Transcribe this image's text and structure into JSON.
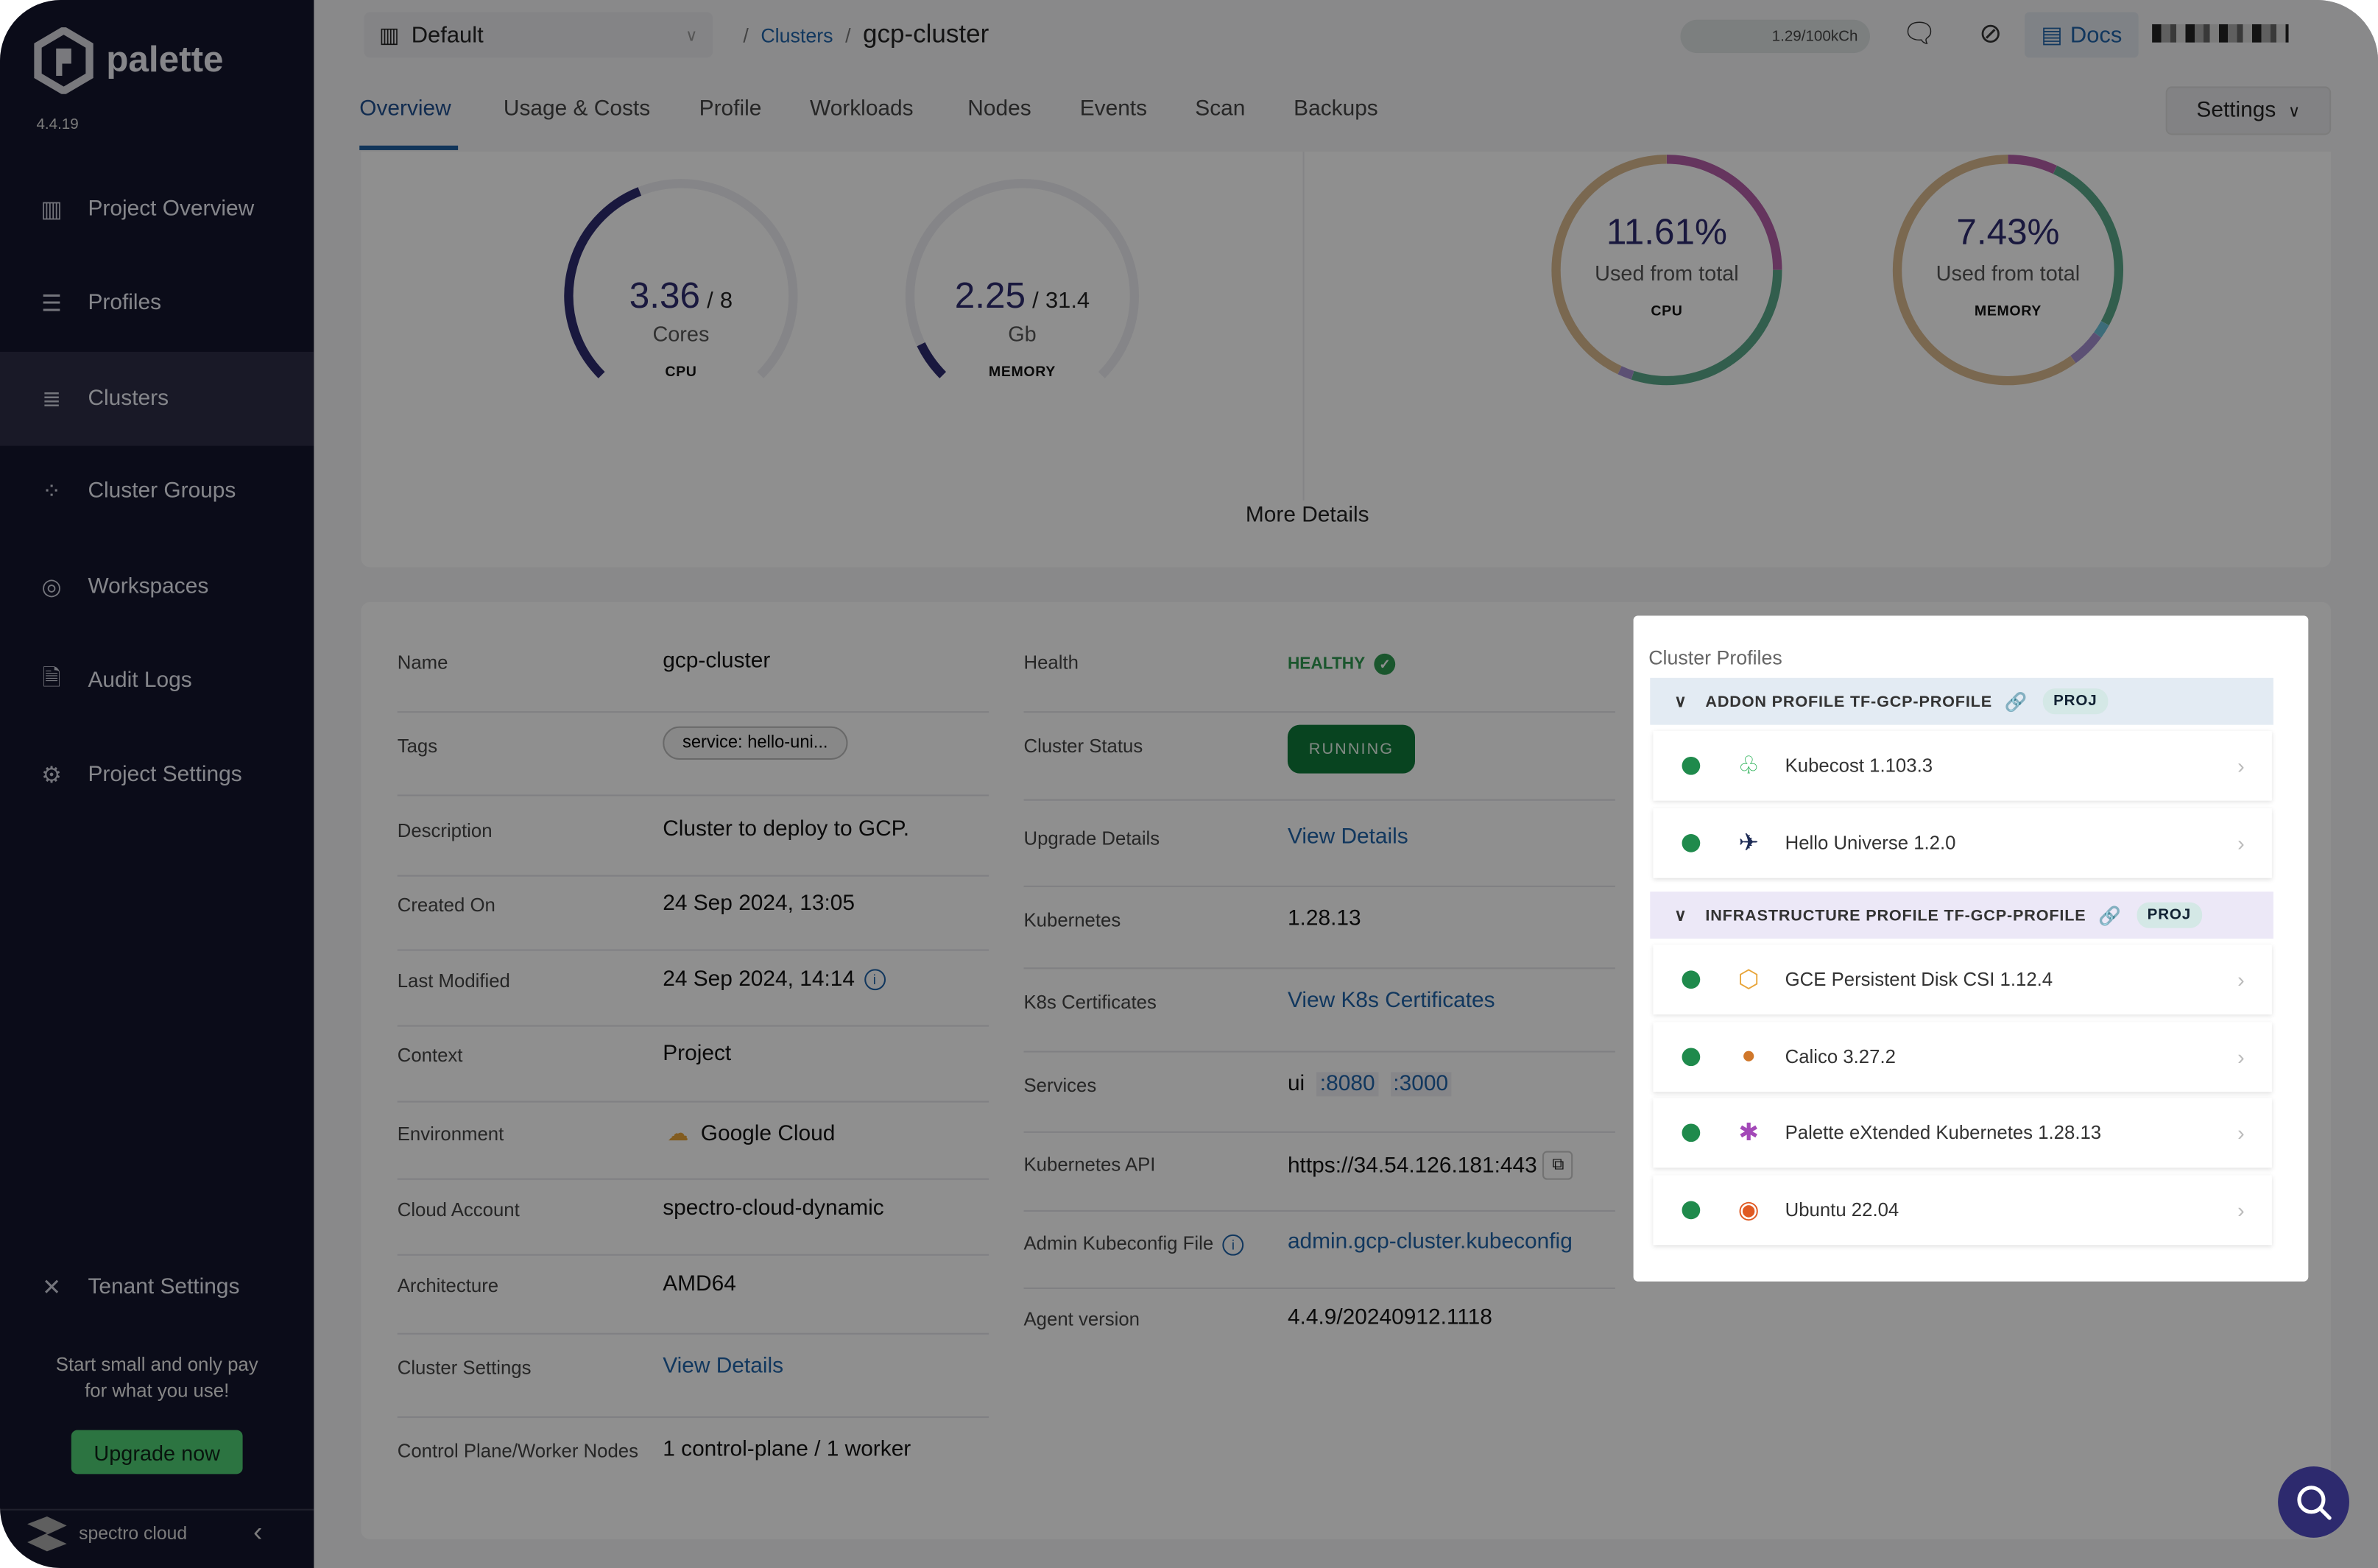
{
  "sidebar": {
    "brand": "palette",
    "version": "4.4.19",
    "items": [
      {
        "label": "Project Overview",
        "icon": "chart-icon"
      },
      {
        "label": "Profiles",
        "icon": "stack-icon"
      },
      {
        "label": "Clusters",
        "icon": "list-icon",
        "active": true
      },
      {
        "label": "Cluster Groups",
        "icon": "nodes-icon"
      },
      {
        "label": "Workspaces",
        "icon": "target-icon"
      },
      {
        "label": "Audit Logs",
        "icon": "file-search-icon"
      },
      {
        "label": "Project Settings",
        "icon": "gear-icon"
      }
    ],
    "tenant_settings": "Tenant Settings",
    "promo_line1": "Start small and only pay",
    "promo_line2": "for what you use!",
    "upgrade": "Upgrade now",
    "footer_brand": "spectro cloud"
  },
  "header": {
    "project": "Default",
    "breadcrumb_parent": "Clusters",
    "breadcrumb_current": "gcp-cluster",
    "credits": "1.29/100kCh",
    "docs": "Docs"
  },
  "tabs": [
    "Overview",
    "Usage & Costs",
    "Profile",
    "Workloads",
    "Nodes",
    "Events",
    "Scan",
    "Backups"
  ],
  "active_tab": "Overview",
  "settings_label": "Settings",
  "gauges": [
    {
      "value": "3.36",
      "total": "8",
      "unit": "Cores",
      "caption": "CPU",
      "used": 3.36,
      "max": 8
    },
    {
      "value": "2.25",
      "total": "31.4",
      "unit": "Gb",
      "caption": "MEMORY",
      "used": 2.25,
      "max": 31.4
    }
  ],
  "donuts": [
    {
      "percent": "11.61%",
      "subtitle": "Used from total",
      "caption": "CPU",
      "segments": [
        {
          "fraction": 0.25,
          "color": "#b45ea8"
        },
        {
          "fraction": 0.3,
          "color": "#5aa88a"
        },
        {
          "fraction": 0.02,
          "color": "#a48fd0"
        },
        {
          "fraction": 0.43,
          "color": "#d9b98f"
        }
      ]
    },
    {
      "percent": "7.43%",
      "subtitle": "Used from total",
      "caption": "MEMORY",
      "segments": [
        {
          "fraction": 0.07,
          "color": "#b45ea8"
        },
        {
          "fraction": 0.26,
          "color": "#5aa88a"
        },
        {
          "fraction": 0.02,
          "color": "#6cc0d8"
        },
        {
          "fraction": 0.05,
          "color": "#a48fd0"
        },
        {
          "fraction": 0.6,
          "color": "#d9b98f"
        }
      ]
    }
  ],
  "more_details": "More Details",
  "details_left": [
    {
      "label": "Name",
      "value": "gcp-cluster"
    },
    {
      "label": "Tags",
      "value": "service: hello-uni..."
    },
    {
      "label": "Description",
      "value": "Cluster to deploy to GCP."
    },
    {
      "label": "Created On",
      "value": "24 Sep 2024, 13:05"
    },
    {
      "label": "Last Modified",
      "value": "24 Sep 2024, 14:14"
    },
    {
      "label": "Context",
      "value": "Project"
    },
    {
      "label": "Environment",
      "value": "Google Cloud"
    },
    {
      "label": "Cloud Account",
      "value": "spectro-cloud-dynamic"
    },
    {
      "label": "Architecture",
      "value": "AMD64"
    },
    {
      "label": "Cluster Settings",
      "value": "View Details"
    },
    {
      "label": "Control Plane/Worker Nodes",
      "value": "1 control-plane / 1 worker"
    }
  ],
  "details_right": [
    {
      "label": "Health",
      "value": "HEALTHY"
    },
    {
      "label": "Cluster Status",
      "value": "RUNNING"
    },
    {
      "label": "Upgrade Details",
      "value": "View Details"
    },
    {
      "label": "Kubernetes",
      "value": "1.28.13"
    },
    {
      "label": "K8s Certificates",
      "value": "View K8s Certificates"
    },
    {
      "label": "Services",
      "value": "ui",
      "ports": [
        ":8080",
        ":3000"
      ]
    },
    {
      "label": "Kubernetes API",
      "value": "https://34.54.126.181:443"
    },
    {
      "label": "Admin Kubeconfig File",
      "value": "admin.gcp-cluster.kubeconfig"
    },
    {
      "label": "Agent version",
      "value": "4.4.9/20240912.1118"
    }
  ],
  "cluster_profiles": {
    "title": "Cluster Profiles",
    "groups": [
      {
        "name": "ADDON PROFILE TF-GCP-PROFILE",
        "badge": "PROJ",
        "color": "#e3ebf3",
        "items": [
          {
            "name": "Kubecost 1.103.3",
            "icon": "kubecost-icon"
          },
          {
            "name": "Hello Universe 1.2.0",
            "icon": "hello-universe-icon"
          }
        ]
      },
      {
        "name": "INFRASTRUCTURE PROFILE TF-GCP-PROFILE",
        "badge": "PROJ",
        "color": "#ece8f7",
        "items": [
          {
            "name": "GCE Persistent Disk CSI 1.12.4",
            "icon": "gce-icon"
          },
          {
            "name": "Calico 3.27.2",
            "icon": "calico-icon"
          },
          {
            "name": "Palette eXtended Kubernetes 1.28.13",
            "icon": "pxk-icon"
          },
          {
            "name": "Ubuntu 22.04",
            "icon": "ubuntu-icon"
          }
        ]
      }
    ]
  },
  "colors": {
    "accent": "#1f63a8",
    "sidebar": "#0b0c1e",
    "healthy": "#2e9a50",
    "running": "#0e7a3a",
    "gauge": "#2d2a6e"
  }
}
